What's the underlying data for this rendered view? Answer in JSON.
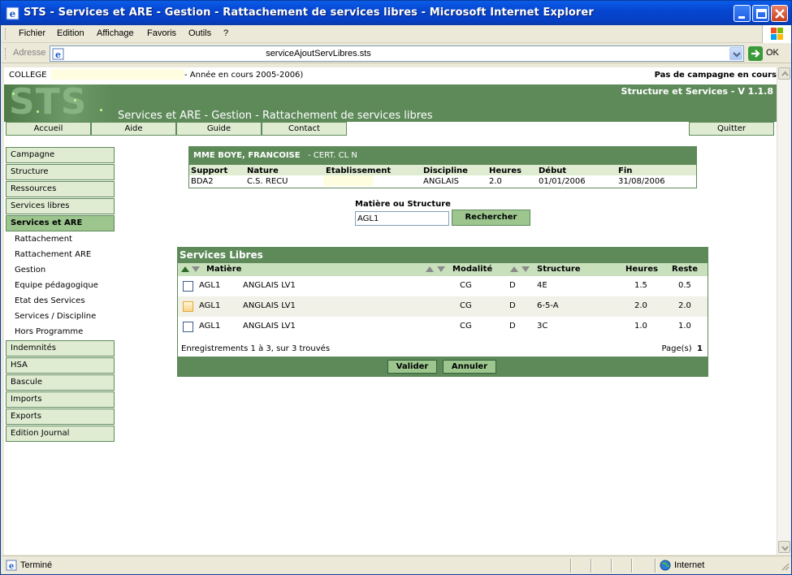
{
  "window": {
    "title": "STS - Services et ARE - Gestion - Rattachement de services libres - Microsoft Internet Explorer"
  },
  "menu": [
    "Fichier",
    "Edition",
    "Affichage",
    "Favoris",
    "Outils",
    "?"
  ],
  "address": {
    "label": "Adresse",
    "url": "serviceAjoutServLibres.sts",
    "go_label": "OK"
  },
  "app": {
    "college_label": "COLLEGE",
    "annee": "- Année en cours 2005-2006)",
    "campagne": "Pas de campagne en cours",
    "logo_text": "STS",
    "version": "Structure et Services - V 1.1.8",
    "page_title": "Services et ARE - Gestion - Rattachement de services libres",
    "nav": [
      "Accueil",
      "Aide",
      "Guide",
      "Contact"
    ],
    "quit": "Quitter"
  },
  "sidebar": {
    "items_top": [
      "Campagne",
      "Structure",
      "Ressources",
      "Services libres"
    ],
    "active": "Services et ARE",
    "subitems": [
      "Rattachement",
      "Rattachement ARE",
      "Gestion",
      "Equipe pédagogique",
      "Etat des Services",
      "Services / Discipline",
      "Hors Programme"
    ],
    "items_bottom": [
      "Indemnités",
      "HSA",
      "Bascule",
      "Imports",
      "Exports",
      "Edition Journal"
    ]
  },
  "person": {
    "name": "MME BOYE, FRANCOISE",
    "grade": "- CERT. CL N",
    "headers": [
      "Support",
      "Nature",
      "Etablissement",
      "Discipline",
      "Heures",
      "Début",
      "Fin"
    ],
    "values": [
      "BDA2",
      "C.S. RECU",
      "",
      "ANGLAIS",
      "2.0",
      "01/01/2006",
      "31/08/2006"
    ]
  },
  "search": {
    "label": "Matière ou Structure",
    "value": "AGL1",
    "button": "Rechercher"
  },
  "services": {
    "title": "Services Libres",
    "headers": {
      "matiere": "Matière",
      "modalite": "Modalité",
      "structure": "Structure",
      "heures": "Heures",
      "reste": "Reste"
    },
    "rows": [
      {
        "code": "AGL1",
        "libelle": "ANGLAIS LV1",
        "modalite": "CG",
        "type": "D",
        "structure": "4E",
        "heures": "1.5",
        "reste": "0.5"
      },
      {
        "code": "AGL1",
        "libelle": "ANGLAIS LV1",
        "modalite": "CG",
        "type": "D",
        "structure": "6-5-A",
        "heures": "2.0",
        "reste": "2.0"
      },
      {
        "code": "AGL1",
        "libelle": "ANGLAIS LV1",
        "modalite": "CG",
        "type": "D",
        "structure": "3C",
        "heures": "1.0",
        "reste": "1.0"
      }
    ],
    "footer": "Enregistrements 1 à 3, sur 3 trouvés",
    "pages_label": "Page(s)",
    "page_current": "1",
    "validate": "Valider",
    "cancel": "Annuler"
  },
  "status": {
    "text": "Terminé",
    "zone": "Internet"
  }
}
